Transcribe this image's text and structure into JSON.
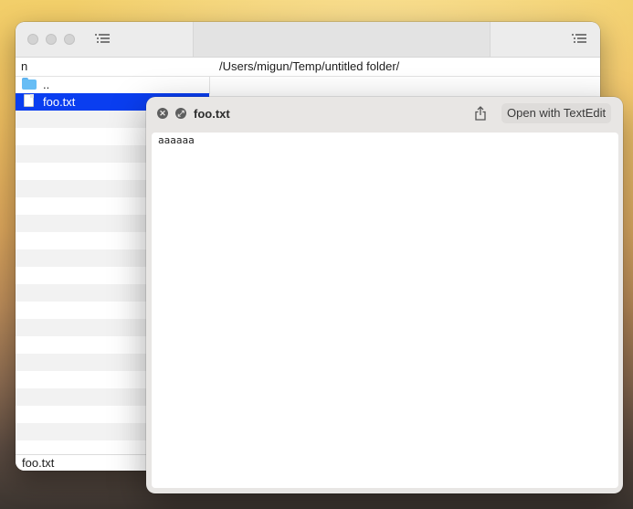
{
  "finder": {
    "columns": {
      "name": "n",
      "path": "/Users/migun/Temp/untitled folder/"
    },
    "items": [
      {
        "label": "..",
        "icon": "folder-icon"
      },
      {
        "label": "foo.txt",
        "icon": "text-file-icon",
        "selected": true
      }
    ],
    "status": "foo.txt"
  },
  "quicklook": {
    "title": "foo.txt",
    "open_with_label": "Open with TextEdit",
    "content": "aaaaaa"
  },
  "colors": {
    "selection": "#0a3ef0",
    "folder": "#67bdf5"
  }
}
